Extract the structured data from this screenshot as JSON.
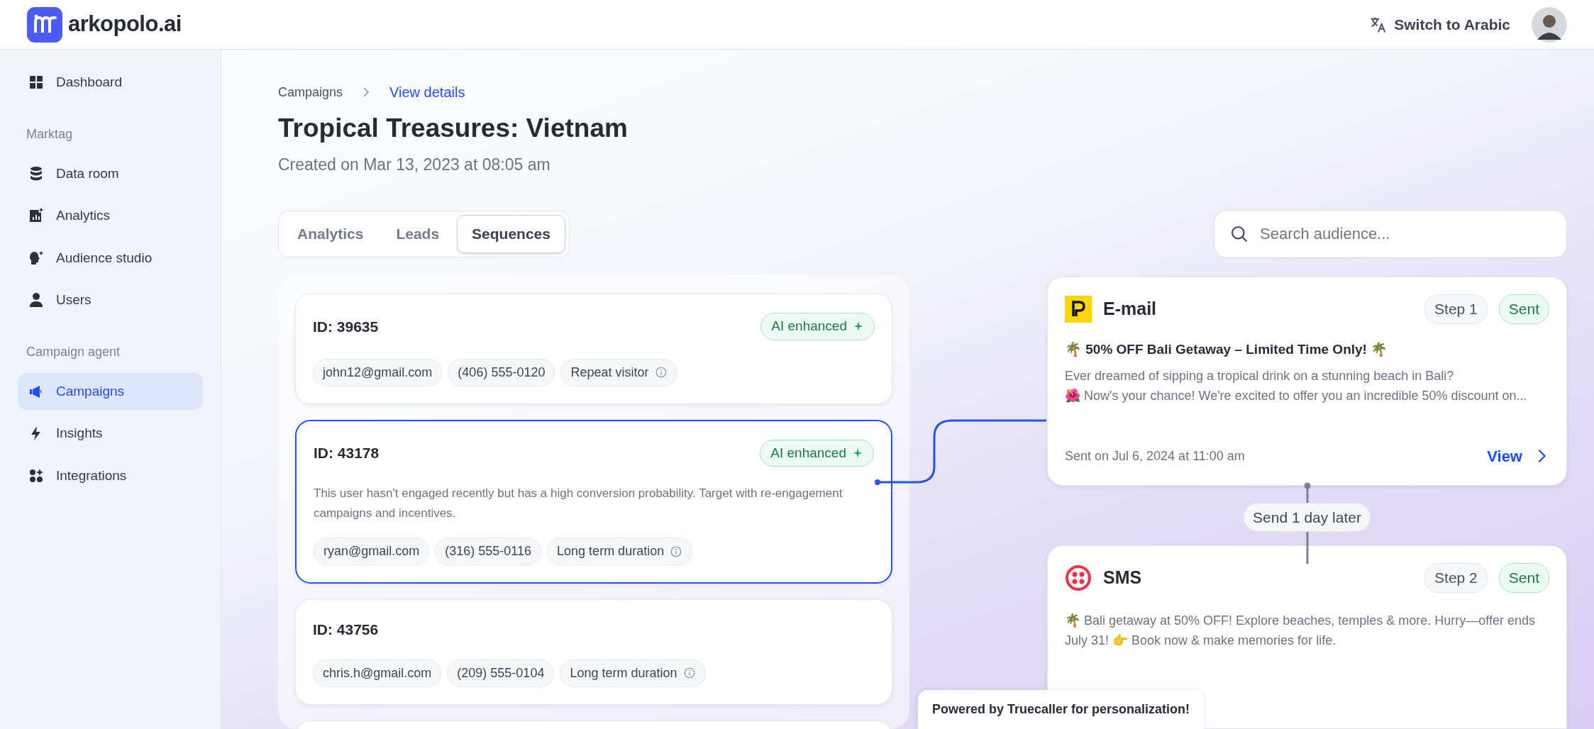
{
  "header": {
    "logo_text": "arkopolo.ai",
    "language_button": "Switch to Arabic"
  },
  "sidebar": {
    "items": [
      {
        "kind": "link",
        "label": "Dashboard",
        "selected": false
      },
      {
        "kind": "section",
        "label": "Marktag"
      },
      {
        "kind": "link",
        "label": "Data room",
        "selected": false
      },
      {
        "kind": "link",
        "label": "Analytics",
        "selected": false
      },
      {
        "kind": "link",
        "label": "Audience studio",
        "selected": false
      },
      {
        "kind": "link",
        "label": "Users",
        "selected": false
      },
      {
        "kind": "section",
        "label": "Campaign agent"
      },
      {
        "kind": "link",
        "label": "Campaigns",
        "selected": true
      },
      {
        "kind": "link",
        "label": "Insights",
        "selected": false
      },
      {
        "kind": "link",
        "label": "Integrations",
        "selected": false
      }
    ]
  },
  "breadcrumb": [
    {
      "label": "Campaigns",
      "selected": false
    },
    {
      "label": "View details",
      "selected": true
    }
  ],
  "title": "Tropical Treasures: Vietnam",
  "subtitle": "Created on Mar 13, 2023 at 08:05 am",
  "tabs": [
    {
      "label": "Analytics",
      "selected": false
    },
    {
      "label": "Leads",
      "selected": false
    },
    {
      "label": "Sequences",
      "selected": true
    }
  ],
  "search": {
    "placeholder": "Search audience..."
  },
  "leads": [
    {
      "id": "ID: 39635",
      "badge": "AI enhanced",
      "selected": false,
      "tags": [
        "john12@gmail.com",
        "(406) 555-0120",
        "Repeat visitor"
      ]
    },
    {
      "id": "ID: 43178",
      "badge": "AI enhanced",
      "selected": true,
      "note": "This user hasn't engaged recently but has a high conversion probability. Target with re-engagement campaigns and incentives.",
      "tags": [
        "ryan@gmail.com",
        "(316) 555-0116",
        "Long term duration"
      ]
    },
    {
      "id": "ID: 43756",
      "selected": false,
      "tags": [
        "chris.h@gmail.com",
        "(209) 555-0104",
        "Long term duration"
      ]
    }
  ],
  "toast": "Powered by Truecaller for personalization!",
  "steps": [
    {
      "kind": "email",
      "channel": "E-mail",
      "step": "Step 1",
      "status": "Sent",
      "subject": "🌴 50% OFF Bali Getaway – Limited Time Only! 🌴",
      "body": [
        "Ever dreamed of sipping a tropical drink on a stunning beach in Bali?",
        "🌺 Now's your chance! We're excited to offer you an incredible 50% discount on..."
      ],
      "sent_on": "Sent on Jul 6, 2024 at 11:00 am",
      "action": "View"
    },
    {
      "kind": "sms",
      "channel": "SMS",
      "step": "Step 2",
      "status": "Sent",
      "body": [
        "🌴 Bali getaway at 50% OFF! Explore beaches, temples & more. Hurry—offer ends July 31! 👉 Book now & make memories for life."
      ]
    }
  ],
  "delay": "Send 1 day later"
}
